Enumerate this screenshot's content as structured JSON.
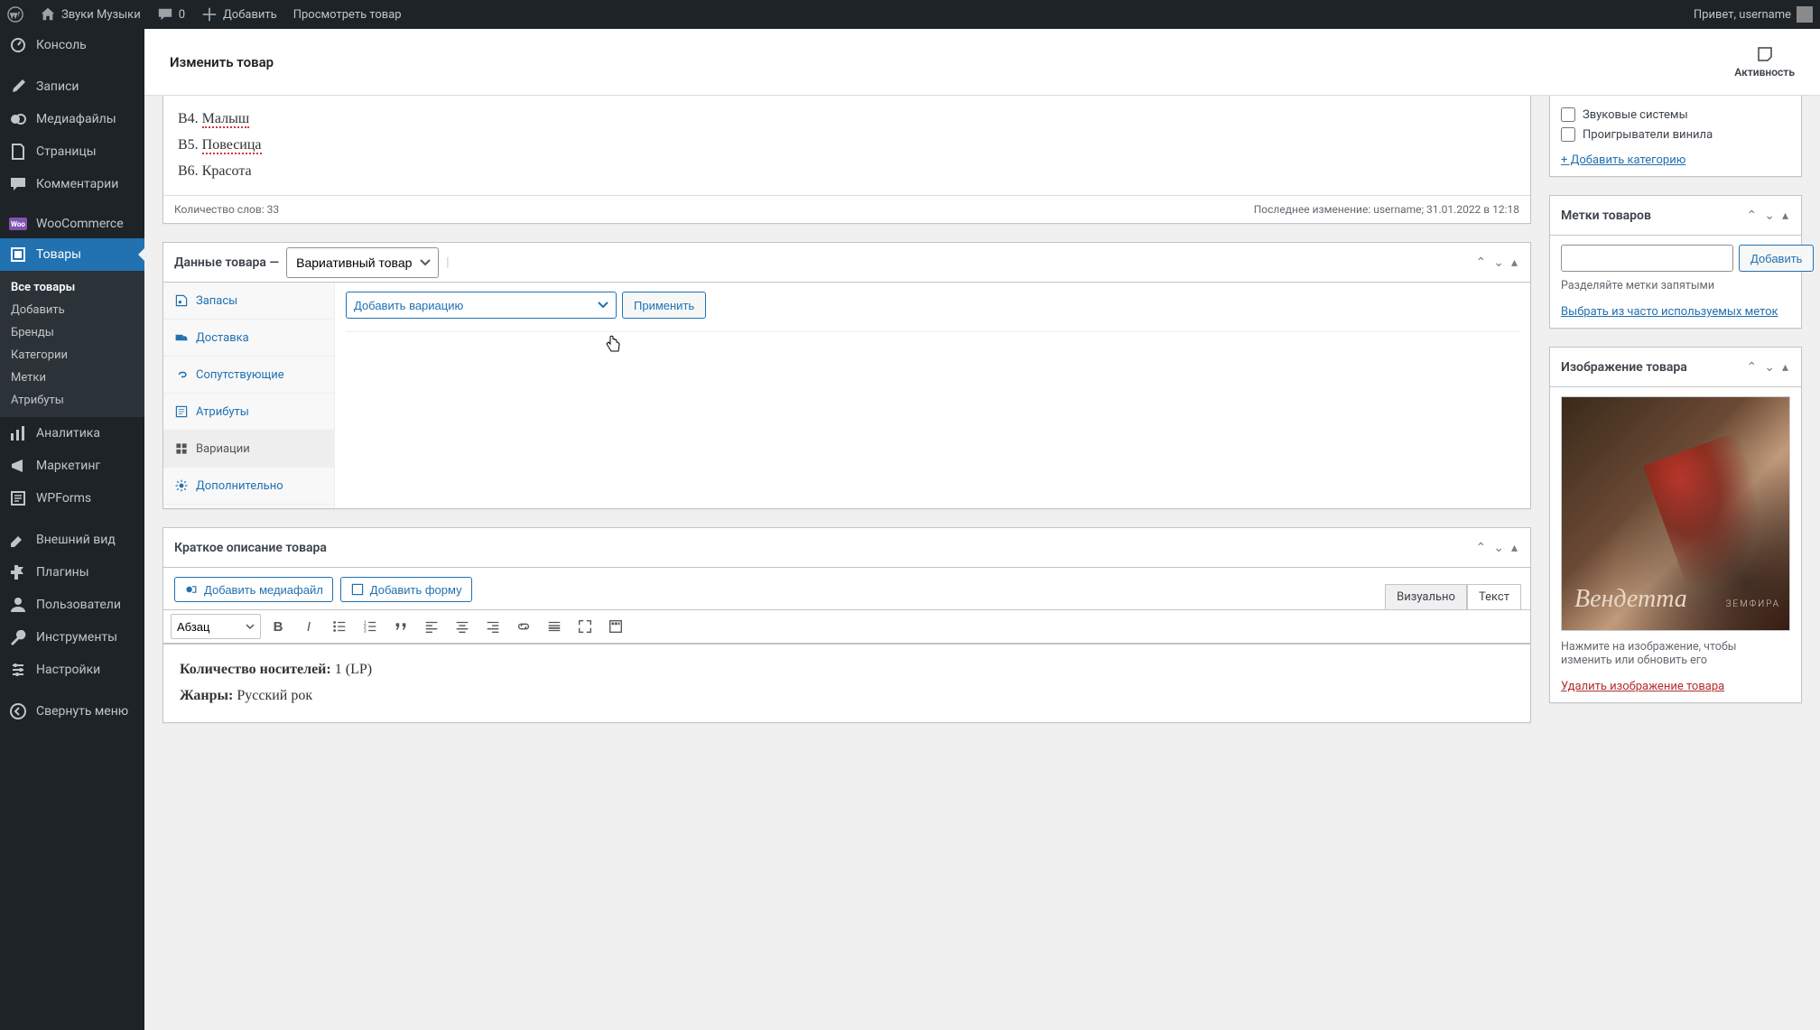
{
  "adminbar": {
    "site": "Звуки Музыки",
    "comments": "0",
    "add": "Добавить",
    "view": "Просмотреть товар",
    "greeting": "Привет, username"
  },
  "sidebar": {
    "console": "Консоль",
    "posts": "Записи",
    "media": "Медиафайлы",
    "pages": "Страницы",
    "comments": "Комментарии",
    "woocommerce": "WooCommerce",
    "products": "Товары",
    "sub_all": "Все товары",
    "sub_add": "Добавить",
    "sub_brands": "Бренды",
    "sub_categories": "Категории",
    "sub_tags": "Метки",
    "sub_attributes": "Атрибуты",
    "analytics": "Аналитика",
    "marketing": "Маркетинг",
    "wpforms": "WPForms",
    "appearance": "Внешний вид",
    "plugins": "Плагины",
    "users": "Пользователи",
    "tools": "Инструменты",
    "settings": "Настройки",
    "collapse": "Свернуть меню"
  },
  "page": {
    "title": "Изменить товар",
    "activity": "Активность"
  },
  "editor": {
    "lines": {
      "b4_prefix": "B4. ",
      "b4_word": "Малыш",
      "b5_prefix": "B5. ",
      "b5_word": "Повесица",
      "b6": "B6. Красота"
    },
    "wordcount": "Количество слов: 33",
    "lastmod": "Последнее изменение: username; 31.01.2022 в 12:18"
  },
  "product_data": {
    "heading": "Данные товара —",
    "type": "Вариативный товар",
    "tabs": {
      "inventory": "Запасы",
      "shipping": "Доставка",
      "linked": "Сопутствующие",
      "attributes": "Атрибуты",
      "variations": "Вариации",
      "advanced": "Дополнительно"
    },
    "variation_select": "Добавить вариацию",
    "apply": "Применить"
  },
  "short_desc": {
    "heading": "Краткое описание товара",
    "add_media": "Добавить медиафайл",
    "add_form": "Добавить форму",
    "tab_visual": "Визуально",
    "tab_text": "Текст",
    "fmt": "Абзац",
    "line1_label": "Количество носителей:",
    "line1_value": " 1 (LP)",
    "line2_label": "Жанры:",
    "line2_value": " Русский рок"
  },
  "categories": {
    "opt1": "Звуковые системы",
    "opt2": "Проигрыватели винила",
    "add": "+ Добавить категорию"
  },
  "tags": {
    "heading": "Метки товаров",
    "add": "Добавить",
    "helper": "Разделяйте метки запятыми",
    "choose": "Выбрать из часто используемых меток"
  },
  "image": {
    "heading": "Изображение товара",
    "script_text": "Вендетта",
    "artist_text": "ЗЕМФИРА",
    "hint": "Нажмите на изображение, чтобы изменить или обновить его",
    "remove": "Удалить изображение товара"
  }
}
